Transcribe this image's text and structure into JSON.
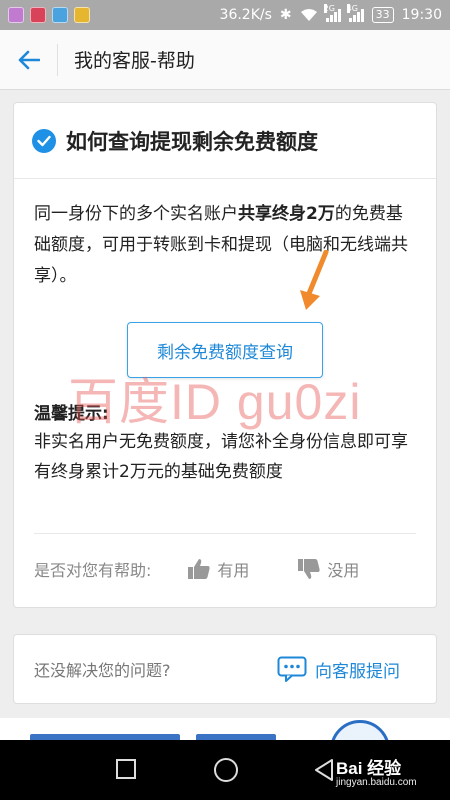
{
  "status_bar": {
    "speed": "36.2K/s",
    "net_2g": "2G",
    "net_4g": "4G",
    "battery": "33",
    "time": "19:30"
  },
  "header": {
    "title": "我的客服-帮助",
    "back_icon": "arrow-left-icon"
  },
  "card": {
    "title": "如何查询提现剩余免费额度",
    "body_prefix": "同一身份下的多个实名账户",
    "body_bold": "共享终身2万",
    "body_suffix": "的免费基础额度，可用于转账到卡和提现（电脑和无线端共享）。",
    "query_button": "剩余免费额度查询",
    "tip_title": "温馨提示:",
    "tip_text": "非实名用户无免费额度，请您补全身份信息即可享有终身累计2万元的基础免费额度",
    "feedback_question": "是否对您有帮助:",
    "useful_label": "有用",
    "useless_label": "没用"
  },
  "watermark": "百度ID gu0zi",
  "help": {
    "question": "还没解决您的问题?",
    "ask_label": "向客服提问"
  },
  "brand": {
    "name": "Bai 经验",
    "url": "jingyan.baidu.com"
  },
  "colors": {
    "accent": "#1e88d8",
    "arrow": "#f08a2c",
    "watermark": "#e85050"
  }
}
